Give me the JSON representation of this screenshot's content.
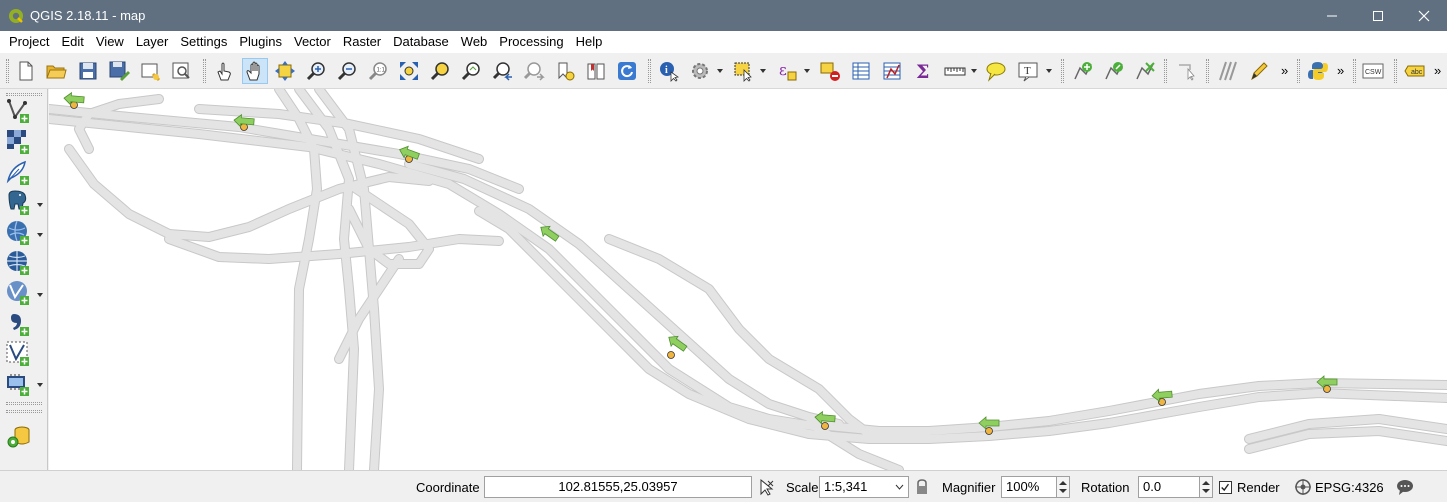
{
  "window": {
    "title": "QGIS 2.18.11 - map",
    "controls": [
      "minimize",
      "maximize",
      "close"
    ]
  },
  "menubar": [
    "Project",
    "Edit",
    "View",
    "Layer",
    "Settings",
    "Plugins",
    "Vector",
    "Raster",
    "Database",
    "Web",
    "Processing",
    "Help"
  ],
  "toolbar": {
    "groups": [
      [
        "new-project",
        "open-project",
        "save-project",
        "save-as",
        "new-print-composer",
        "composer-manager"
      ],
      [
        "touch-zoom",
        "pan-map",
        "pan-to-selection",
        "zoom-in",
        "zoom-out",
        "zoom-actual",
        "zoom-full",
        "zoom-to-selection",
        "zoom-to-layer",
        "zoom-last",
        "zoom-next",
        "new-bookmark",
        "show-bookmarks",
        "refresh"
      ],
      [
        "identify",
        "run-feature-action",
        "select-features",
        "select-by-expression",
        "deselect-all",
        "open-attribute-table",
        "open-field-calculator",
        "statistical-summary",
        "measure-line",
        "map-tips",
        "text-annotation"
      ],
      [
        "georeference-add",
        "georeference-edit",
        "georeference-delete"
      ],
      [
        "digitizing"
      ],
      [
        "advanced-digitizing",
        "current-edits"
      ],
      [
        "python-console"
      ],
      [
        "metasearch-csw"
      ],
      [
        "label-tool"
      ]
    ],
    "csw_label": "CSW",
    "abc_label": "abc",
    "overflow": "»"
  },
  "side_toolbar": [
    "add-vector-layer",
    "add-raster-layer",
    "add-spatialite-layer",
    "add-postgis-layer",
    "add-wms-layer",
    "add-wcs-layer",
    "add-wfs-layer",
    "add-delimited-text-layer",
    "add-virtual-layer",
    "add-gpx-layer",
    "new-shapefile-layer"
  ],
  "statusbar": {
    "coordinate_label": "Coordinate",
    "coordinate_value": "102.81555,25.03957",
    "scale_label": "Scale",
    "scale_value": "1:5,341",
    "magnifier_label": "Magnifier",
    "magnifier_value": "100%",
    "rotation_label": "Rotation",
    "rotation_value": "0.0",
    "render_label": "Render",
    "render_checked": true,
    "crs_label": "EPSG:4326"
  },
  "map": {
    "background": "#ffffff",
    "road_fill": "#e4e4e4",
    "road_outline": "#c8c8c8",
    "marker_color": "#f0b440",
    "arrow_color": "#8fcf5f"
  }
}
